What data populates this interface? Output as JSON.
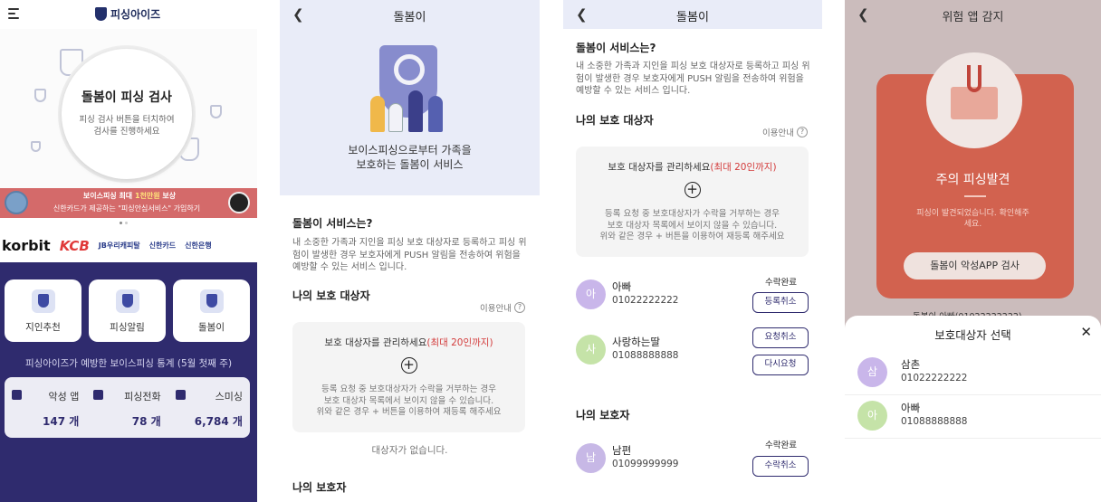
{
  "screen1": {
    "app_name": "피싱아이즈",
    "hero_title": "돌봄이 피싱 검사",
    "hero_desc": "피싱 검사 버튼을 터치하여 검사를 진행하세요",
    "banner_line1_prefix": "보이스피싱 최대 ",
    "banner_line1_highlight": "1천만원",
    "banner_line1_suffix": " 보상",
    "banner_line2": "신한카드가 제공하는 \"피싱안심서비스\" 가입하기",
    "partners": [
      "korbit",
      "KCB",
      "JB우리캐피탈",
      "신한카드",
      "신한은행"
    ],
    "tiles": [
      {
        "label": "지인추천",
        "icon": "gift-icon"
      },
      {
        "label": "피싱알림",
        "icon": "alert-icon"
      },
      {
        "label": "돌봄이",
        "icon": "shield-icon"
      }
    ],
    "stats_caption": "피싱아이즈가 예방한 보이스피싱 통계 (5월 첫째 주)",
    "stats": [
      {
        "label": "악성 앱",
        "value": "147 개",
        "icon": "app-icon"
      },
      {
        "label": "피싱전화",
        "value": "78 개",
        "icon": "phone-icon"
      },
      {
        "label": "스미싱",
        "value": "6,784 개",
        "icon": "mail-icon"
      }
    ]
  },
  "screen2": {
    "title": "돌봄이",
    "hero_line1": "보이스피싱으로부터 가족을",
    "hero_line2": "보호하는 돌봄이 서비스",
    "about_title": "돌봄이 서비스는?",
    "about_desc": "내 소중한 가족과 지인을 피싱 보호 대상자로 등록하고 피싱 위험이 발생한 경우 보호자에게 PUSH 알림을 전송하여 위험을 예방할 수 있는 서비스 입니다.",
    "protected_title": "나의 보호 대상자",
    "guide_label": "이용안내",
    "manage_prefix": "보호 대상자를 관리하세요",
    "manage_highlight": "(최대 20인까지)",
    "manage_desc_1": "등록 요청 중 보호대상자가 수락을 거부하는 경우",
    "manage_desc_2": "보호 대상자 목록에서 보이지 않을 수 있습니다.",
    "manage_desc_3": "위와 같은 경우 + 버튼을 이용하여 재등록 해주세요",
    "empty_text": "대상자가 없습니다.",
    "guardian_title": "나의 보호자"
  },
  "screen3": {
    "title": "돌봄이",
    "about_title": "돌봄이 서비스는?",
    "about_desc": "내 소중한 가족과 지인을 피싱 보호 대상자로 등록하고 피싱 위험이 발생한 경우 보호자에게 PUSH 알림을 전송하여 위험을 예방할 수 있는 서비스 입니다.",
    "protected_title": "나의 보호 대상자",
    "guide_label": "이용안내",
    "manage_prefix": "보호 대상자를 관리하세요",
    "manage_highlight": "(최대 20인까지)",
    "manage_desc_1": "등록 요청 중 보호대상자가 수락을 거부하는 경우",
    "manage_desc_2": "보호 대상자 목록에서 보이지 않을 수 있습니다.",
    "manage_desc_3": "위와 같은 경우 + 버튼을 이용하여 재등록 해주세요",
    "protected": [
      {
        "initial": "아",
        "name": "아빠",
        "phone": "01022222222",
        "status": "수락완료",
        "buttons": [
          "등록취소"
        ],
        "color": "#c9b6ea"
      },
      {
        "initial": "사",
        "name": "사랑하는딸",
        "phone": "01088888888",
        "status": "",
        "buttons": [
          "요청취소",
          "다시요청"
        ],
        "color": "#c5e3a8"
      }
    ],
    "guardian_title": "나의 보호자",
    "guardians": [
      {
        "initial": "남",
        "name": "남편",
        "phone": "01099999999",
        "status": "수락완료",
        "buttons": [
          "수락취소"
        ],
        "color": "#c7b8e6"
      }
    ]
  },
  "screen4": {
    "title": "위험 앱 감지",
    "alert_title": "주의 피싱발견",
    "alert_desc_1": "피싱이 발견되었습니다. 확인해주",
    "alert_desc_2": "세요.",
    "scan_button": "돌봄이 악성APP 검사",
    "peek_text": "돌봄이 아빠(01022222222)",
    "sheet_title": "보호대상자 선택",
    "close_icon": "close-icon",
    "contacts": [
      {
        "initial": "삼",
        "name": "삼촌",
        "phone": "01022222222",
        "color": "#c9b6ea"
      },
      {
        "initial": "아",
        "name": "아빠",
        "phone": "01088888888",
        "color": "#c5e3a8"
      }
    ]
  },
  "colors": {
    "brand_navy": "#2f2b6e",
    "banner_red": "#d46a6a",
    "highlight_red": "#d33c3c",
    "danger_card": "#d2624f",
    "hero_bg": "#e9ecf8"
  }
}
